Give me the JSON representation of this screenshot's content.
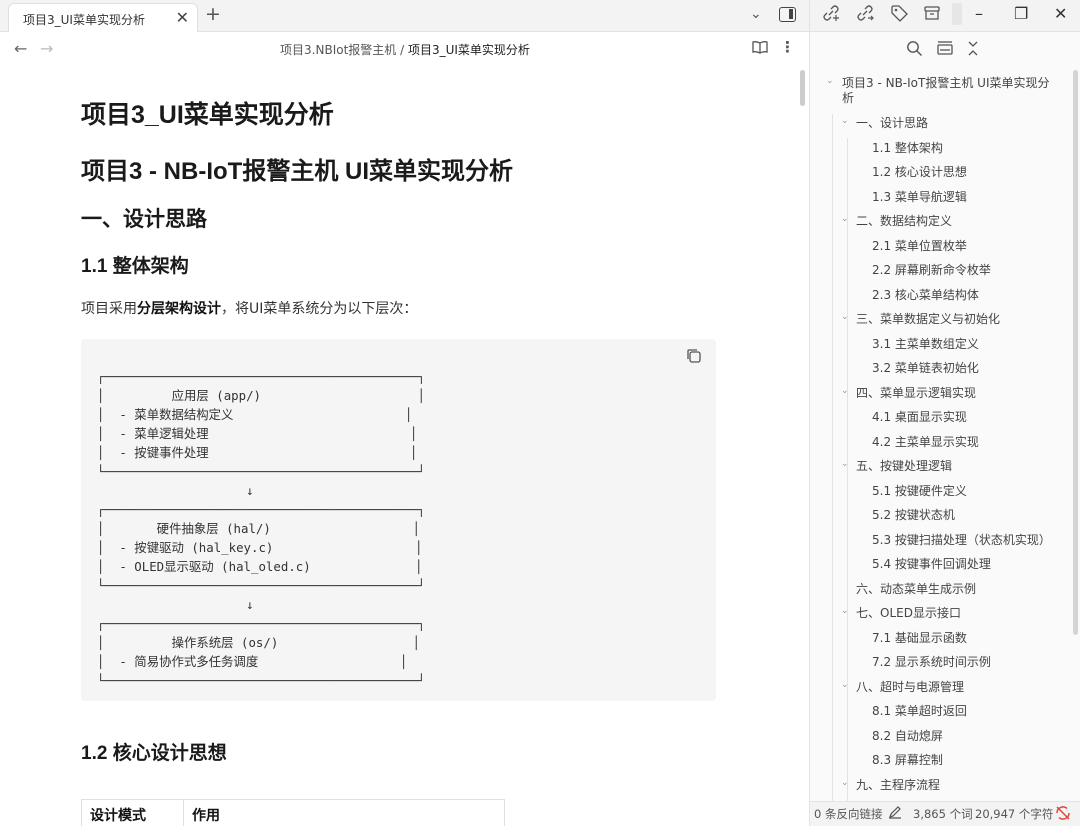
{
  "tab": {
    "title": "项目3_UI菜单实现分析",
    "close": "✕",
    "add": "+"
  },
  "tabbar": {
    "dropdown": "⌄"
  },
  "nav": {
    "back": "←",
    "forward": "→",
    "more": "⋮",
    "book": "📖"
  },
  "breadcrumb": {
    "parent": "项目3.NBIot报警主机",
    "separator": " / ",
    "current": "项目3_UI菜单实现分析"
  },
  "doc": {
    "h1": "项目3_UI菜单实现分析",
    "h1b": "项目3 - NB-IoT报警主机 UI菜单实现分析",
    "h2": "一、设计思路",
    "h3a": "1.1 整体架构",
    "para_prefix": "项目采用",
    "para_bold": "分层架构设计",
    "para_suffix": "，将UI菜单系统分为以下层次：",
    "code_lines": [
      "┌──────────────────────────────────────────┐",
      "│         应用层 (app/)                     │",
      "│  - 菜单数据结构定义                       │",
      "│  - 菜单逻辑处理                           │",
      "│  - 按键事件处理                           │",
      "└──────────────────────────────────────────┘",
      "                    ↓",
      "┌──────────────────────────────────────────┐",
      "│       硬件抽象层 (hal/)                   │",
      "│  - 按键驱动 (hal_key.c)                   │",
      "│  - OLED显示驱动 (hal_oled.c)              │",
      "└──────────────────────────────────────────┘",
      "                    ↓",
      "┌──────────────────────────────────────────┐",
      "│         操作系统层 (os/)                  │",
      "│  - 简易协作式多任务调度                   │",
      "└──────────────────────────────────────────┘"
    ],
    "h3b": "1.2 核心设计思想",
    "table_headers": [
      "设计模式",
      "作用"
    ]
  },
  "window": {
    "minimize": "–",
    "restore": "❐",
    "close": "✕"
  },
  "outline": [
    {
      "label": "项目3 - NB-IoT报警主机 UI菜单实现分",
      "label2": "析",
      "level": 0,
      "chevron": true
    },
    {
      "label": "一、设计思路",
      "level": 1,
      "chevron": true
    },
    {
      "label": "1.1 整体架构",
      "level": 2
    },
    {
      "label": "1.2 核心设计思想",
      "level": 2
    },
    {
      "label": "1.3 菜单导航逻辑",
      "level": 2
    },
    {
      "label": "二、数据结构定义",
      "level": 1,
      "chevron": true
    },
    {
      "label": "2.1 菜单位置枚举",
      "level": 2
    },
    {
      "label": "2.2 屏幕刷新命令枚举",
      "level": 2
    },
    {
      "label": "2.3 核心菜单结构体",
      "level": 2
    },
    {
      "label": "三、菜单数据定义与初始化",
      "level": 1,
      "chevron": true
    },
    {
      "label": "3.1 主菜单数组定义",
      "level": 2
    },
    {
      "label": "3.2 菜单链表初始化",
      "level": 2
    },
    {
      "label": "四、菜单显示逻辑实现",
      "level": 1,
      "chevron": true
    },
    {
      "label": "4.1 桌面显示实现",
      "level": 2
    },
    {
      "label": "4.2 主菜单显示实现",
      "level": 2
    },
    {
      "label": "五、按键处理逻辑",
      "level": 1,
      "chevron": true
    },
    {
      "label": "5.1 按键硬件定义",
      "level": 2
    },
    {
      "label": "5.2 按键状态机",
      "level": 2
    },
    {
      "label": "5.3 按键扫描处理（状态机实现）",
      "level": 2
    },
    {
      "label": "5.4 按键事件回调处理",
      "level": 2
    },
    {
      "label": "六、动态菜单生成示例",
      "level": 1,
      "chevron": false
    },
    {
      "label": "七、OLED显示接口",
      "level": 1,
      "chevron": true
    },
    {
      "label": "7.1 基础显示函数",
      "level": 2
    },
    {
      "label": "7.2 显示系统时间示例",
      "level": 2
    },
    {
      "label": "八、超时与电源管理",
      "level": 1,
      "chevron": true
    },
    {
      "label": "8.1 菜单超时返回",
      "level": 2
    },
    {
      "label": "8.2 自动熄屏",
      "level": 2
    },
    {
      "label": "8.3 屏幕控制",
      "level": 2
    },
    {
      "label": "九、主程序流程",
      "level": 1,
      "chevron": true
    }
  ],
  "status": {
    "backlinks": "0 条反向链接",
    "words": "3,865 个词",
    "chars": "20,947 个字符",
    "accent": "#e0443c"
  }
}
